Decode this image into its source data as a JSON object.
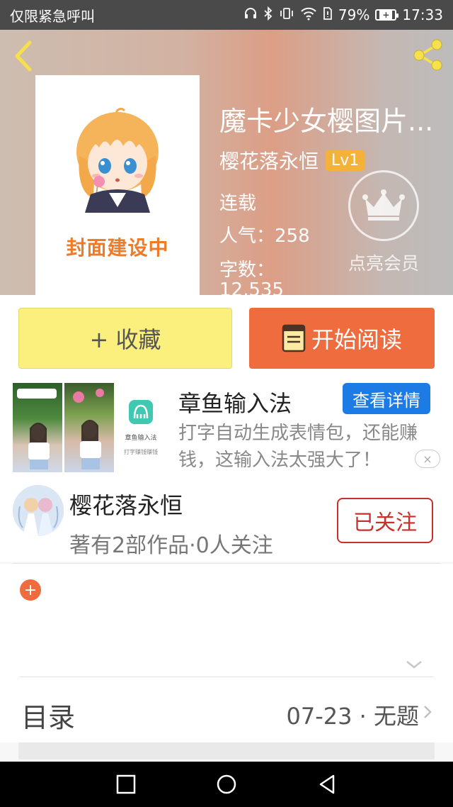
{
  "status_bar": {
    "carrier": "仅限紧急呼叫",
    "battery_percent": "79%",
    "battery_glyph": "+",
    "time": "17:33",
    "icons": [
      "headphones-icon",
      "bluetooth-icon",
      "vibrate-icon",
      "wifi-icon",
      "sim-icon",
      "battery-icon"
    ]
  },
  "book": {
    "cover_text": "封面建设中",
    "title": "魔卡少女樱图片...",
    "author": "樱花落永恒",
    "level": "Lv1",
    "status": "连载",
    "popularity_label": "人气：",
    "popularity": "258",
    "word_count_label": "字数：",
    "word_count": "12,535"
  },
  "vip": {
    "label": "点亮会员",
    "icon": "crown-icon"
  },
  "actions": {
    "collect": "+ 收藏",
    "read": "开始阅读",
    "read_icon": "book-icon"
  },
  "ad": {
    "title": "章鱼输入法",
    "detail_button": "查看详情",
    "description": "打字自动生成表情包，还能赚钱，这输入法太强大了！",
    "close": "×",
    "thumb3_caption": "章鱼输入法",
    "thumb3_sub": "打字赚钱赚钱"
  },
  "author_card": {
    "name": "樱花落永恒",
    "stats": "著有2部作品·0人关注",
    "follow_button": "已关注"
  },
  "tags": {
    "add": "+"
  },
  "catalog": {
    "label": "目录",
    "latest": "07-23 · 无题"
  },
  "colors": {
    "accent_orange": "#ee6c3d",
    "collect_yellow": "#fbf07e",
    "follow_red": "#c9302c",
    "ad_blue": "#1d7be5",
    "level_badge": "#f5b23a"
  }
}
